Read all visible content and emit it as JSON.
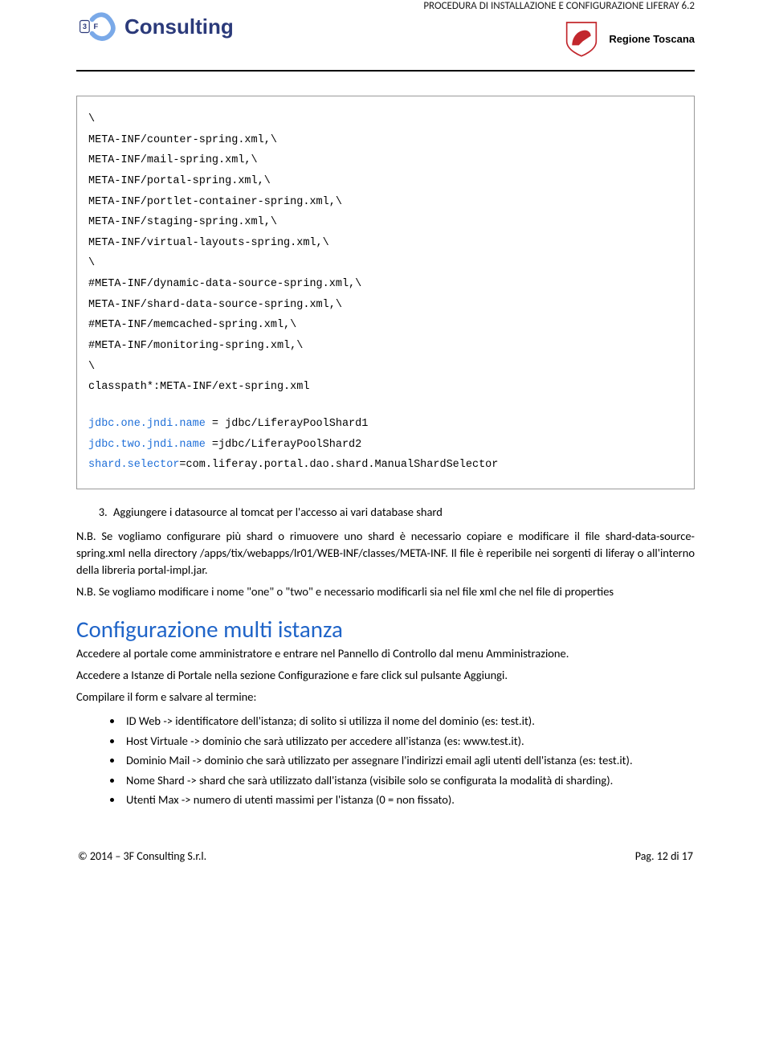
{
  "header": {
    "doc_title": "PROCEDURA DI INSTALLAZIONE E CONFIGURAZIONE LIFERAY 6.2",
    "logo_consulting": "Consulting",
    "regione_text": "Regione Toscana"
  },
  "code": {
    "l1": "\\",
    "l2": "META-INF/counter-spring.xml,\\",
    "l3": "META-INF/mail-spring.xml,\\",
    "l4": "META-INF/portal-spring.xml,\\",
    "l5": "META-INF/portlet-container-spring.xml,\\",
    "l6": "META-INF/staging-spring.xml,\\",
    "l7": "META-INF/virtual-layouts-spring.xml,\\",
    "l8": "\\",
    "l9": "#META-INF/dynamic-data-source-spring.xml,\\",
    "l10": "META-INF/shard-data-source-spring.xml,\\",
    "l11": "#META-INF/memcached-spring.xml,\\",
    "l12": "#META-INF/monitoring-spring.xml,\\",
    "l13": "\\",
    "l14": "classpath*:META-INF/ext-spring.xml",
    "j1a": "jdbc.one.jndi.name",
    "j1b": " = jdbc/LiferayPoolShard1",
    "j2a": "jdbc.two.jndi.name",
    "j2b": " =jdbc/LiferayPoolShard2",
    "j3a": "shard.selector",
    "j3b": "=com.liferay.portal.dao.shard.ManualShardSelector"
  },
  "list3": {
    "item": "Aggiungere i datasource al tomcat per l'accesso ai vari database shard"
  },
  "para": {
    "nb1": "N.B. Se vogliamo configurare più shard o rimuovere uno shard è necessario copiare e modificare il file shard-data-source-spring.xml nella directory /apps/tix/webapps/lr01/WEB-INF/classes/META-INF. Il file è reperibile nei sorgenti di liferay o all'interno della libreria portal-impl.jar.",
    "nb2": "N.B. Se vogliamo modificare i nome \"one\" o \"two\" e necessario modificarli sia nel file xml che nel file di properties"
  },
  "section": {
    "title": "Configurazione multi istanza",
    "p1": "Accedere al portale come amministratore e entrare nel Pannello di Controllo dal menu Amministrazione.",
    "p2": "Accedere a Istanze di Portale nella sezione Configurazione e fare click sul pulsante Aggiungi.",
    "p3": "Compilare il form e salvare al termine:"
  },
  "bullets": {
    "b1": "ID Web -> identificatore dell'istanza; di solito si utilizza il nome del dominio (es: test.it).",
    "b2": "Host Virtuale -> dominio che sarà utilizzato per accedere all'istanza (es: www.test.it).",
    "b3": "Dominio Mail -> dominio che sarà utilizzato per assegnare l'indirizzi email agli utenti dell'istanza (es: test.it).",
    "b4": "Nome Shard -> shard  che sarà utilizzato dall'istanza (visibile solo se configurata la modalità di sharding).",
    "b5": "Utenti Max -> numero di utenti massimi per l'istanza (0 = non fissato)."
  },
  "footer": {
    "left": "© 2014 – 3F Consulting S.r.l.",
    "right": "Pag. 12 di 17"
  }
}
